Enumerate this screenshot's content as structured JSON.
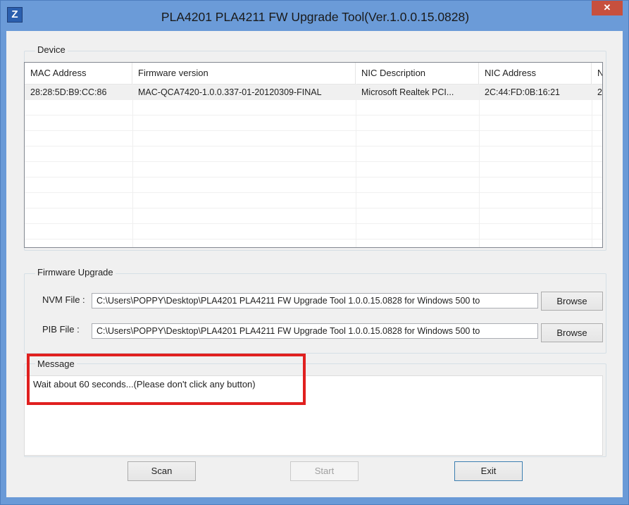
{
  "window": {
    "title": "PLA4201 PLA4211 FW Upgrade Tool(Ver.1.0.0.15.0828)",
    "app_icon_letter": "Z",
    "close_glyph": "✕"
  },
  "device": {
    "group_label": "Device",
    "columns": [
      "MAC Address",
      "Firmware version",
      "NIC Description",
      "NIC Address",
      "N"
    ],
    "rows": [
      [
        "28:28:5D:B9:CC:86",
        "MAC-QCA7420-1.0.0.337-01-20120309-FINAL",
        "Microsoft Realtek PCI...",
        "2C:44:FD:0B:16:21",
        "2"
      ]
    ]
  },
  "firmware": {
    "group_label": "Firmware Upgrade",
    "nvm_label": "NVM File :",
    "nvm_path": "C:\\Users\\POPPY\\Desktop\\PLA4201 PLA4211 FW Upgrade Tool 1.0.0.15.0828 for Windows 500 to",
    "pib_label": "PIB File :",
    "pib_path": "C:\\Users\\POPPY\\Desktop\\PLA4201 PLA4211 FW Upgrade Tool 1.0.0.15.0828 for Windows 500 to",
    "browse_label": "Browse"
  },
  "message": {
    "group_label": "Message",
    "text": "Wait about 60 seconds...(Please don't click any button)"
  },
  "buttons": {
    "scan": "Scan",
    "start": "Start",
    "exit": "Exit"
  },
  "colors": {
    "title_bar": "#6b9bd8",
    "close_button": "#c7503e",
    "highlight": "#e0201f"
  }
}
